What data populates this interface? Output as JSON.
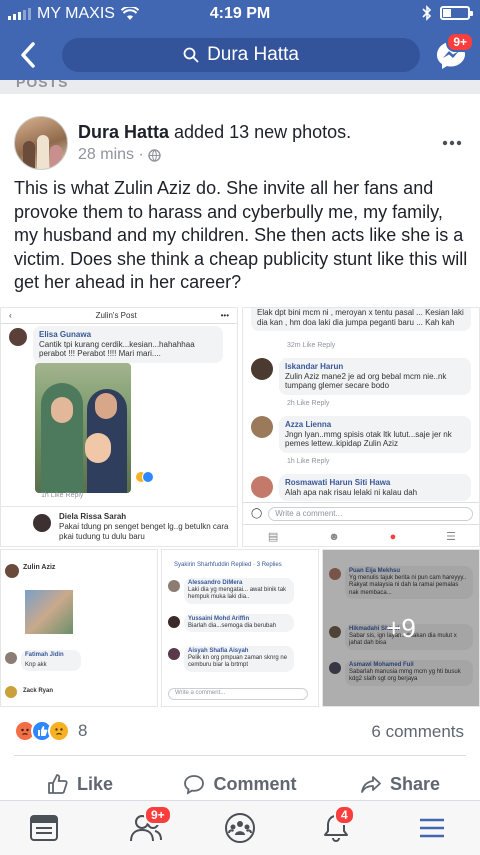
{
  "status_bar": {
    "carrier": "MY MAXIS",
    "time": "4:19 PM"
  },
  "nav": {
    "search_text": "Dura Hatta",
    "messenger_badge": "9+"
  },
  "posts_section_label": "POSTS",
  "post": {
    "author": "Dura Hatta",
    "action": " added 13 new photos.",
    "time": "28 mins ·",
    "text": "This is what Zulin Aziz do. She invite all her fans and provoke them to harass and cyberbully me, my family, my husband and my children. She then acts like she is a victim. Does she think a cheap publicity stunt like this will get her ahead in her career?"
  },
  "photos": {
    "p1": {
      "title": "Zulin's Post",
      "c1_name": "Elisa Gunawa",
      "c1_text": "Cantik tpi kurang cerdik...kesian...hahahhaa perabot !!! Perabot !!!! Mari mari....",
      "c1_meta": "1h   Like   Reply",
      "c2_name": "Diela Rissa Sarah",
      "c2_text": "Pakai tdung pn senget benget lg..g betulkn cara pkai tudung tu dulu baru"
    },
    "p2": {
      "c0_text": "Elak dpt bini mcm ni , meroyan x tentu pasal ... Kesian laki dia kan , hm doa laki dia jumpa peganti baru ... Kah kah",
      "c0_meta": "32m   Like   Reply",
      "c1_name": "Iskandar Harun",
      "c1_text": "Zulin Aziz mane2 je ad org bebal mcm nie..nk tumpang glemer secare bodo",
      "c1_meta": "2h   Like   Reply",
      "c2_name": "Azza Lienna",
      "c2_text": "Jngn lyan..mmg spisis otak ltk lutut...saje jer nk pemes lettew..kipidap Zulin Aziz",
      "c2_meta": "1h   Like   Reply",
      "c3_name": "Rosmawati Harun Siti Hawa",
      "c3_text": "Alah apa nak risau lelaki ni kalau dah",
      "composer": "Write a comment..."
    },
    "p3": {
      "name": "Zulin Aziz",
      "c1_name": "Fatimah Jidin",
      "c1_text": "Knp akk",
      "c2_name": "Zack Ryan"
    },
    "p4": {
      "head": "Syakirin Sharhfuddin Replied · 3 Replies",
      "c1_name": "Alessandro DiMera",
      "c1_text": "Laki dia yg mengatai... awat binik tak hempuk muka laki dia..",
      "c2_name": "Yussaini Mohd Ariffin",
      "c2_text": "Biarlah dia...semoga dia berubah",
      "c3_name": "Aisyah Shafia Aisyah",
      "c3_text": "Pelik kn org pmpuan zaman sknrg ne cemburu biar la brtmpt",
      "composer": "Write a comment..."
    },
    "p5": {
      "c1_name": "Puan Eija Mekhsu",
      "c1_text": "Yg menulis tajuk berita ni pun cam hareyyy.. Rakyat malaysia ni dah la ramai pemalas nak membaca...",
      "c2_name": "Hikmadahi Shaari",
      "c2_text": "Sabar sis, ign layan...doakan dia mulut x jahat dah bisa",
      "c3_name": "Asmawi Mohamed Fuil",
      "c3_text": "Sabarlah manusia mmg mcm yg hti busuk kdg2 slalh sgt org berjaya",
      "more_label": "+9"
    }
  },
  "engagement": {
    "reaction_count": "8",
    "comments": "6 comments"
  },
  "actions": {
    "like": "Like",
    "comment": "Comment",
    "share": "Share"
  },
  "tabs": {
    "friends_badge": "9+",
    "notifications_badge": "4"
  },
  "colors": {
    "brand": "#4267b2",
    "badge": "#fa3e3e",
    "like_blue": "#2d88ff",
    "angry": "#f26f45",
    "sad": "#f7b125"
  }
}
